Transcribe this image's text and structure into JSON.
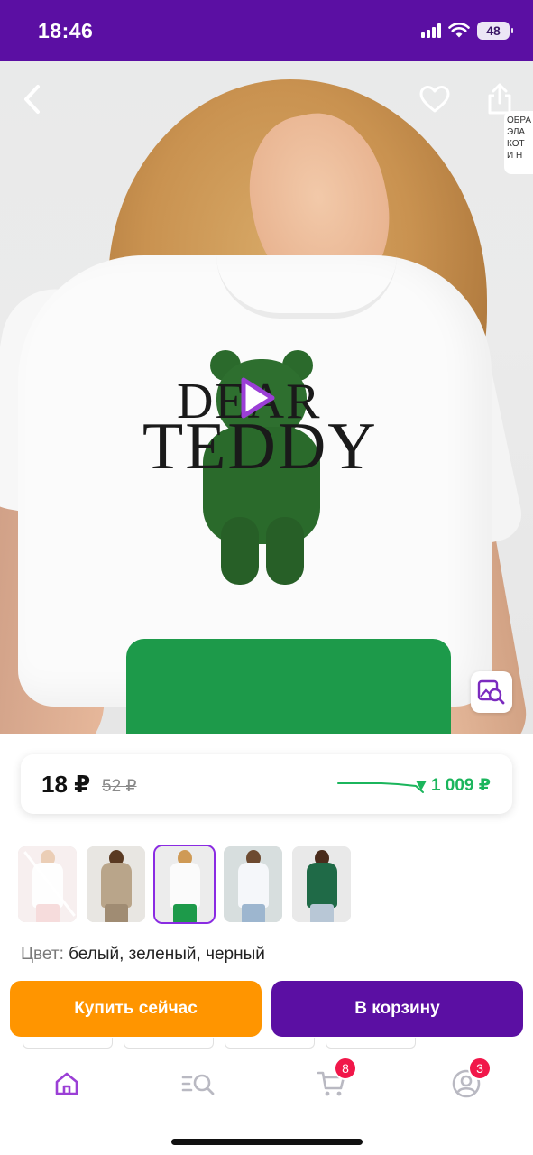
{
  "status_bar": {
    "time": "18:46",
    "battery": "48"
  },
  "hero": {
    "print_line_1": "DEAR",
    "print_line_2": "TEDDY",
    "side_card_lines": [
      "ОБРА",
      "ЭЛА",
      "КОТ",
      "И Н"
    ]
  },
  "price": {
    "current": "18 ₽",
    "old": "52 ₽",
    "history": "1 009 ₽"
  },
  "thumbnails": [
    {
      "name": "thumb-1",
      "state": "unavailable"
    },
    {
      "name": "thumb-2",
      "state": "normal"
    },
    {
      "name": "thumb-3",
      "state": "selected"
    },
    {
      "name": "thumb-4",
      "state": "normal"
    },
    {
      "name": "thumb-5",
      "state": "normal"
    }
  ],
  "color": {
    "label": "Цвет:",
    "value": "белый, зеленый, черный"
  },
  "actions": {
    "buy_now": "Купить сейчас",
    "add_to_cart": "В корзину"
  },
  "nav": {
    "cart_badge": "8",
    "profile_badge": "3",
    "icons": [
      "home-icon",
      "catalog-search-icon",
      "cart-icon",
      "profile-icon"
    ]
  },
  "colors": {
    "brand": "#5b0fa3",
    "buy": "#ff9500",
    "price_drop": "#1bb55c",
    "badge": "#f1174a"
  }
}
